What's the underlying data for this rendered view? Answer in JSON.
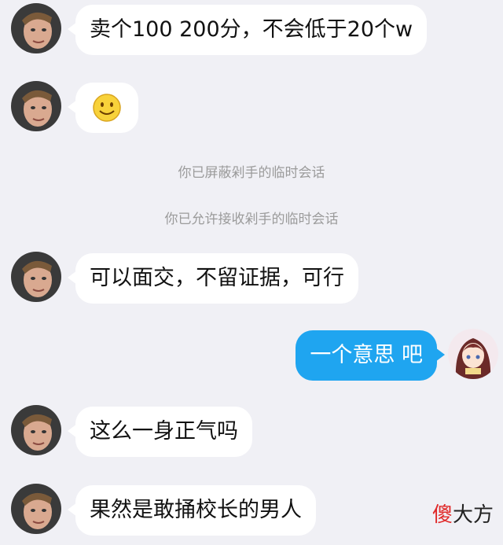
{
  "messages": [
    {
      "side": "left",
      "text": "卖个100 200分，不会低于20个w"
    },
    {
      "side": "left",
      "text": "",
      "emoji": "smiley"
    },
    {
      "side": "left",
      "text": "可以面交，不留证据，可行"
    },
    {
      "side": "right",
      "text": "一个意思 吧"
    },
    {
      "side": "left",
      "text": "这么一身正气吗"
    },
    {
      "side": "left",
      "text": "果然是敢捅校长的男人"
    }
  ],
  "system": [
    "你已屏蔽剁手的临时会话",
    "你已允许接收剁手的临时会话"
  ],
  "watermark": {
    "red": "傻",
    "rest": "大方"
  },
  "colors": {
    "background": "#f0f0f5",
    "bubble_left": "#ffffff",
    "bubble_right": "#1fa5f0",
    "system_text": "#9b9b9b"
  }
}
